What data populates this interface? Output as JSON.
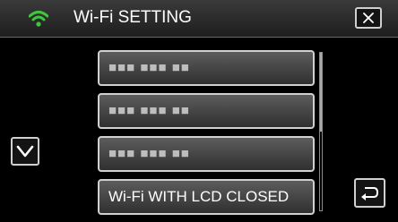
{
  "header": {
    "title": "Wi-Fi SETTING",
    "wifi_icon": "wifi-signal-icon",
    "wifi_color": "#3fc53f",
    "close_icon": "close-x-icon"
  },
  "list": {
    "items": [
      {
        "label": "■■■ ■■■ ■■",
        "masked": true
      },
      {
        "label": "■■■ ■■■ ■■",
        "masked": true
      },
      {
        "label": "■■■ ■■■ ■■",
        "masked": true
      },
      {
        "label": "Wi-Fi WITH LCD CLOSED",
        "masked": false
      }
    ],
    "scroll_position": 0,
    "scroll_visible_fraction": 0.5
  },
  "controls": {
    "scroll_down_icon": "chevron-down-icon",
    "back_icon": "return-arrow-icon"
  }
}
